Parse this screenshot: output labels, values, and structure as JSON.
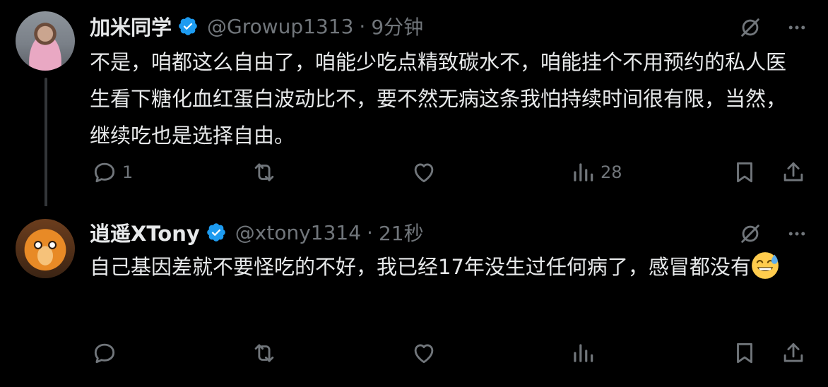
{
  "tweets": [
    {
      "display_name": "加米同学",
      "handle": "@Growup1313",
      "separator": "·",
      "time": "9分钟",
      "text": "不是，咱都这么自由了，咱能少吃点精致碳水不，咱能挂个不用预约的私人医生看下糖化血红蛋白波动比不，要不然无病这条我怕持续时间很有限，当然，继续吃也是选择自由。",
      "actions": {
        "replies": "1",
        "retweets": "",
        "likes": "",
        "views": "28"
      }
    },
    {
      "display_name": "逍遥XTony",
      "handle": "@xtony1314",
      "separator": "·",
      "time": "21秒",
      "text": "自己基因差就不要怪吃的不好，我已经17年没生过任何病了，感冒都没有",
      "emoji": "sweat-smile-emoji",
      "actions": {
        "replies": "",
        "retweets": "",
        "likes": "",
        "views": ""
      }
    }
  ],
  "colors": {
    "background": "#000000",
    "text_primary": "#e7e9ea",
    "text_secondary": "#71767b",
    "verified_blue": "#1d9bf0",
    "thread_line": "#333639"
  },
  "icons": [
    "grok-icon",
    "more-icon",
    "verified-icon",
    "reply-icon",
    "retweet-icon",
    "like-icon",
    "views-icon",
    "bookmark-icon",
    "share-icon"
  ]
}
